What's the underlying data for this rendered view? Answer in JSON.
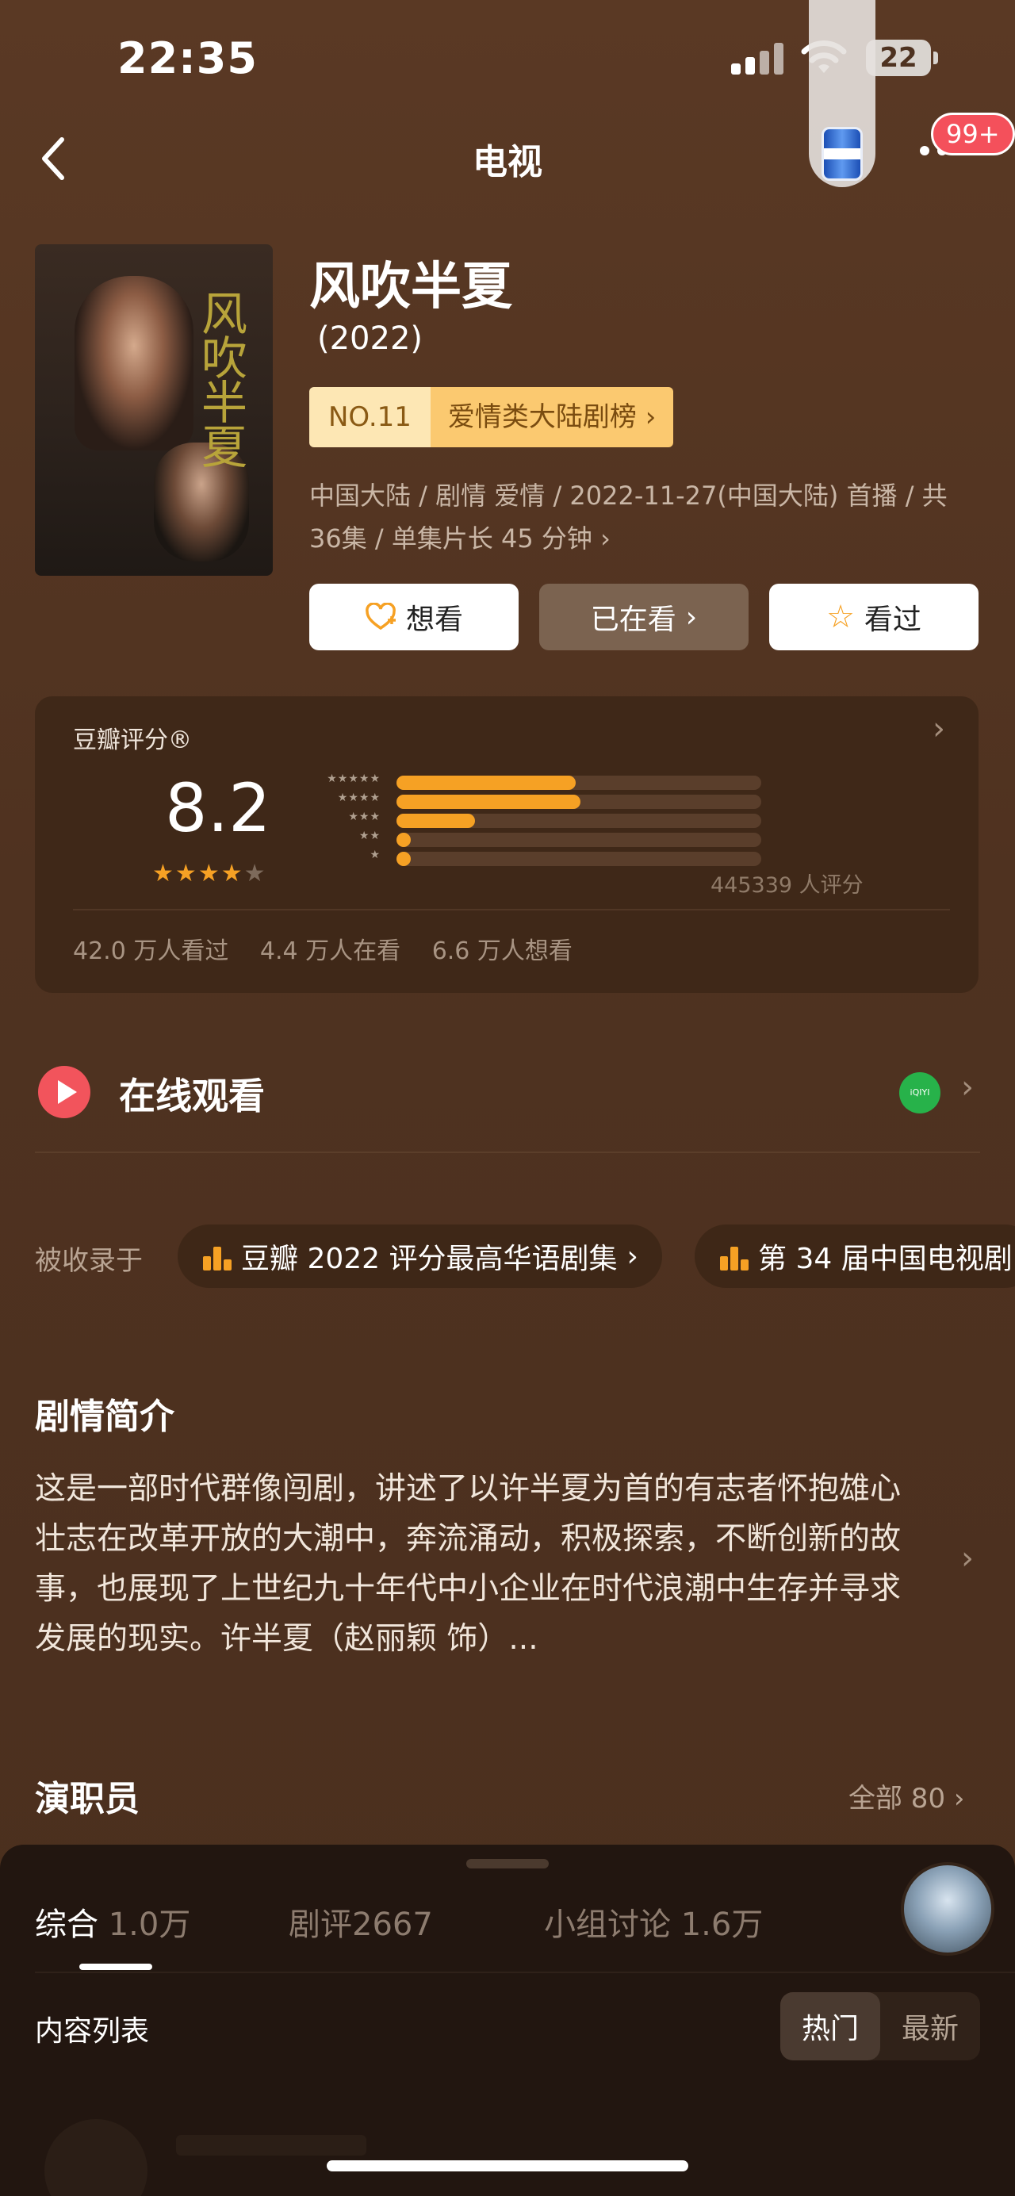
{
  "status_bar": {
    "time": "22:35",
    "battery": "22"
  },
  "nav": {
    "title": "电视",
    "badge": "99+"
  },
  "show": {
    "title": "风吹半夏",
    "year": "(2022)",
    "rank_no": "NO.11",
    "rank_category": "爱情类大陆剧榜",
    "meta": "中国大陆 / 剧情 爱情 / 2022-11-27(中国大陆) 首播 / 共36集 / 单集片长 45 分钟",
    "poster_art": "风吹半夏",
    "actions": {
      "want": "想看",
      "watching": "已在看",
      "watched": "看过"
    }
  },
  "rating": {
    "label": "豆瓣评分®",
    "score": "8.2",
    "stars_filled": 4,
    "star_levels": [
      "★★★★★",
      "★★★★",
      "★★★",
      "★★",
      "★"
    ],
    "distribution": [
      0.39,
      0.4,
      0.17,
      0.03,
      0.03
    ],
    "count_text": "445339 人评分",
    "stats": [
      "42.0 万人看过",
      "4.4 万人在看",
      "6.6 万人想看"
    ]
  },
  "online": {
    "label": "在线观看",
    "provider": "iQIYI"
  },
  "collections": {
    "label": "被收录于",
    "chips": [
      "豆瓣 2022 评分最高华语剧集",
      "第 34 届中国电视剧"
    ]
  },
  "synopsis": {
    "title": "剧情简介",
    "text": "这是一部时代群像闯剧，讲述了以许半夏为首的有志者怀抱雄心壮志在改革开放的大潮中，奔流涌动，积极探索，不断创新的故事，也展现了上世纪九十年代中小企业在时代浪潮中生存并寻求发展的现实。许半夏（赵丽颖 饰）..."
  },
  "cast": {
    "title": "演职员",
    "all_label": "全部 80"
  },
  "sheet": {
    "tabs": [
      {
        "label": "综合",
        "count": "1.0万"
      },
      {
        "label": "剧评",
        "count": "2667"
      },
      {
        "label": "小组讨论",
        "count": "1.6万"
      }
    ],
    "list_label": "内容列表",
    "sort_options": [
      "热门",
      "最新"
    ],
    "sort_selected": "热门"
  },
  "colors": {
    "accent_orange": "#f6a124",
    "play_red": "#f2545c",
    "rank_bg": "#fbc970"
  }
}
